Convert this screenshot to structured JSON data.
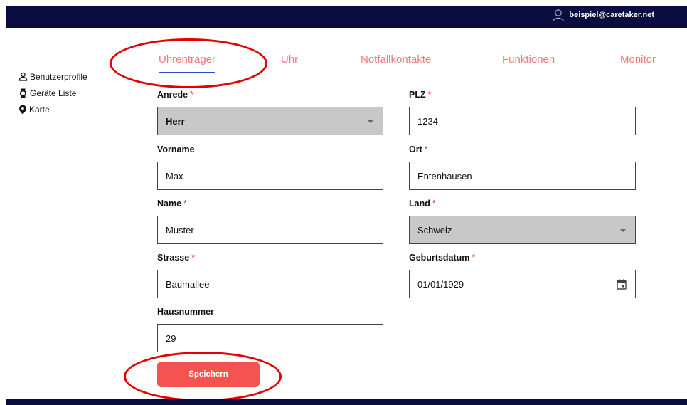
{
  "header": {
    "user_email": "beispiel@caretaker.net"
  },
  "sidebar": {
    "items": [
      {
        "label": "Benutzerprofile",
        "icon": "user-icon"
      },
      {
        "label": "Geräte Liste",
        "icon": "watch-icon"
      },
      {
        "label": "Karte",
        "icon": "map-pin-icon"
      }
    ]
  },
  "tabs": [
    {
      "label": "Uhrenträger",
      "active": true
    },
    {
      "label": "Uhr",
      "active": false
    },
    {
      "label": "Notfallkontakte",
      "active": false
    },
    {
      "label": "Funktionen",
      "active": false
    },
    {
      "label": "Monitor",
      "active": false
    }
  ],
  "form": {
    "required_mark": "*",
    "anrede": {
      "label": "Anrede",
      "value": "Herr"
    },
    "vorname": {
      "label": "Vorname",
      "value": "Max"
    },
    "name": {
      "label": "Name",
      "value": "Muster"
    },
    "strasse": {
      "label": "Strasse",
      "value": "Baumallee"
    },
    "hausnummer": {
      "label": "Hausnummer",
      "value": "29"
    },
    "plz": {
      "label": "PLZ",
      "value": "1234"
    },
    "ort": {
      "label": "Ort",
      "value": "Entenhausen"
    },
    "land": {
      "label": "Land",
      "value": "Schweiz"
    },
    "geburtsdatum": {
      "label": "Geburtsdatum",
      "value": "01/01/1929"
    },
    "save_label": "Speichern"
  },
  "colors": {
    "topbar": "#0b0c3f",
    "tab_text": "#f4787a",
    "tab_active_underline": "#2a4ad0",
    "required": "#e03a3a",
    "save_button": "#f5534f",
    "annotation": "#e30000"
  }
}
